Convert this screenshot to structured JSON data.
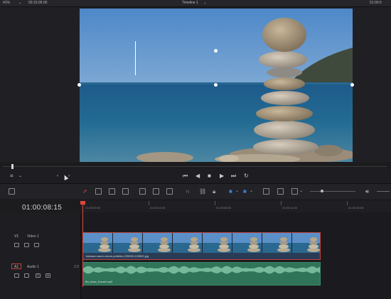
{
  "topbar": {
    "zoom": "41%",
    "timecode": "00:15:05:00",
    "timeline_name": "Timeline 1",
    "timecode_right": "01:00:0"
  },
  "viewer": {
    "content": "stacked-stones-photo"
  },
  "transport": {
    "icons": [
      "skip-back-icon",
      "play-reverse-icon",
      "stop-icon",
      "play-icon",
      "skip-forward-icon",
      "loop-icon"
    ]
  },
  "timeline": {
    "current_timecode": "01:00:08:15",
    "ruler_ticks": [
      "01:00:00:00",
      "01:00:04:00",
      "01:00:08:00",
      "01:00:12:00",
      "01:00:16:00"
    ]
  },
  "tracks": {
    "video": {
      "id": "V1",
      "name": "Video 1",
      "clip_name": "banana-macro-stone-pebbles-225990-225990.jpg"
    },
    "audio": {
      "id": "A1",
      "name": "Audio 1",
      "count": "2.0",
      "clip_name": "Bo_bass_Sound.mp3",
      "solo": "S",
      "mute": "M"
    }
  },
  "colors": {
    "accent_red": "#e0463e",
    "audio_green": "#2f7358",
    "background": "#1c1c1f"
  }
}
